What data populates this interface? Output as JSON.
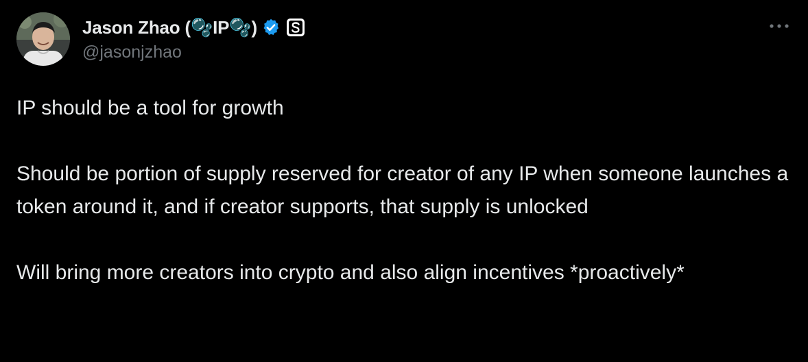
{
  "author": {
    "display_name": "Jason Zhao (🫧IP🫧)",
    "handle": "@jasonjzhao",
    "verified": true,
    "avatar_icon": "profile-photo",
    "affiliate_badge_icon": "s-badge-icon"
  },
  "tweet": {
    "paragraphs": [
      "IP should be a tool for growth",
      "Should be portion of supply reserved for creator of any IP when someone launches a token around it, and if creator supports, that supply is unlocked",
      "Will bring more creators into crypto and also align incentives *proactively*"
    ]
  },
  "more_icon": "ellipsis-icon",
  "colors": {
    "background": "#000000",
    "text": "#e7e9ea",
    "secondary": "#71767b",
    "verified": "#1d9bf0"
  }
}
